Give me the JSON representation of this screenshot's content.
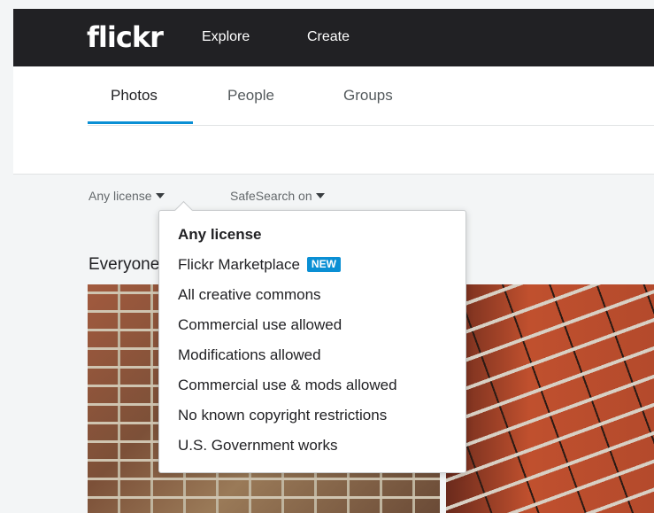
{
  "header": {
    "logo": "flickr",
    "nav": {
      "explore": "Explore",
      "create": "Create"
    }
  },
  "tabs": [
    {
      "label": "Photos",
      "active": true
    },
    {
      "label": "People",
      "active": false
    },
    {
      "label": "Groups",
      "active": false
    }
  ],
  "filters": {
    "license": "Any license",
    "safesearch": "SafeSearch on"
  },
  "section": {
    "title": "Everyone's photos"
  },
  "license_menu": {
    "items": [
      {
        "label": "Any license",
        "selected": true
      },
      {
        "label": "Flickr Marketplace",
        "badge": "NEW"
      },
      {
        "label": "All creative commons"
      },
      {
        "label": "Commercial use allowed"
      },
      {
        "label": "Modifications allowed"
      },
      {
        "label": "Commercial use & mods allowed"
      },
      {
        "label": "No known copyright restrictions"
      },
      {
        "label": "U.S. Government works"
      }
    ]
  },
  "colors": {
    "topbar": "#212124",
    "accent": "#0a8fd4",
    "badge_bg": "#0a8fd4"
  },
  "icons": {
    "caret": "caret-down-icon"
  }
}
